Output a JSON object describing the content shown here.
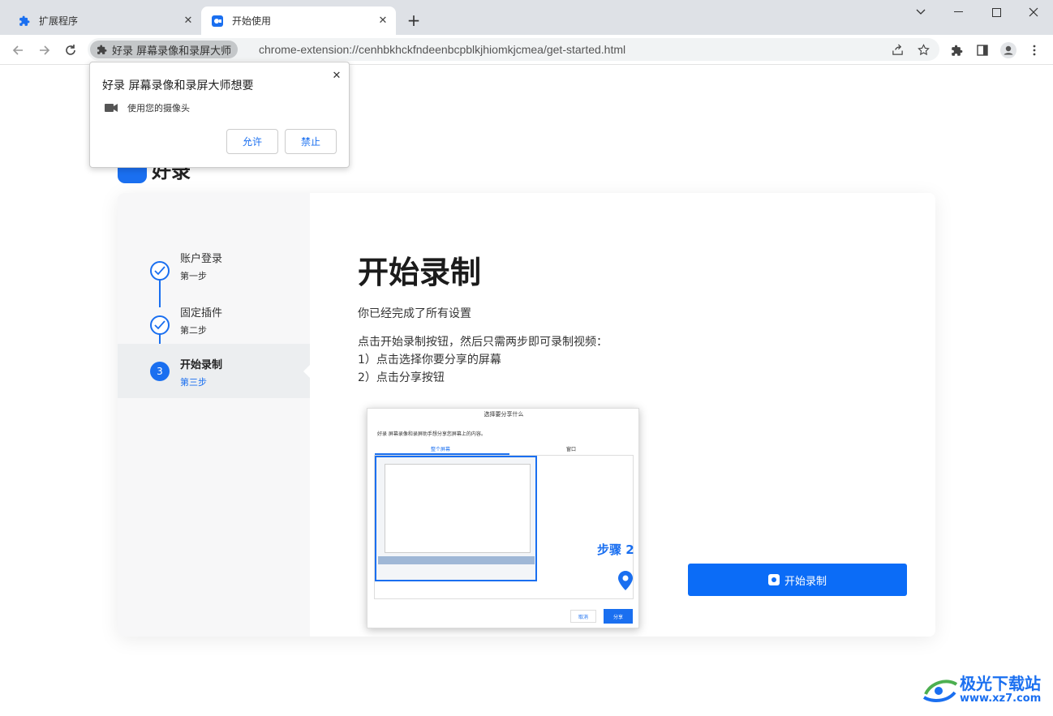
{
  "browser": {
    "tabs": [
      {
        "label": "扩展程序",
        "active": false
      },
      {
        "label": "开始使用",
        "active": true
      }
    ],
    "ext_chip": "好录 屏幕录像和录屏大师",
    "url": "chrome-extension://cenhbkhckfndeenbcpblkjhiomkjcmea/get-started.html"
  },
  "permission_popup": {
    "title": "好录 屏幕录像和录屏大师想要",
    "item": "使用您的摄像头",
    "allow_label": "允许",
    "block_label": "禁止"
  },
  "page": {
    "logo_text": "好录",
    "steps": [
      {
        "title": "账户登录",
        "sub": "第一步",
        "state": "done"
      },
      {
        "title": "固定插件",
        "sub": "第二步",
        "state": "done"
      },
      {
        "title": "开始录制",
        "sub": "第三步",
        "state": "active",
        "number": "3"
      }
    ],
    "heading": "开始录制",
    "para1": "你已经完成了所有设置",
    "para2": "点击开始录制按钮，然后只需两步即可录制视频：",
    "item1": "1）点击选择你要分享的屏幕",
    "item2": "2）点击分享按钮",
    "screenshot": {
      "title": "选择要分享什么",
      "subtitle": "好录  屏幕录像和录屏助手想分享您屏幕上的内容。",
      "tab_screen": "整个屏幕",
      "tab_window": "窗口",
      "step_label": "步骤 2",
      "cancel": "取消",
      "share": "分享"
    },
    "start_button": "开始录制"
  },
  "watermark": {
    "line1": "极光下载站",
    "line2": "www.xz7.com"
  },
  "colors": {
    "accent": "#1a6ff0",
    "button": "#0b6cf7"
  }
}
